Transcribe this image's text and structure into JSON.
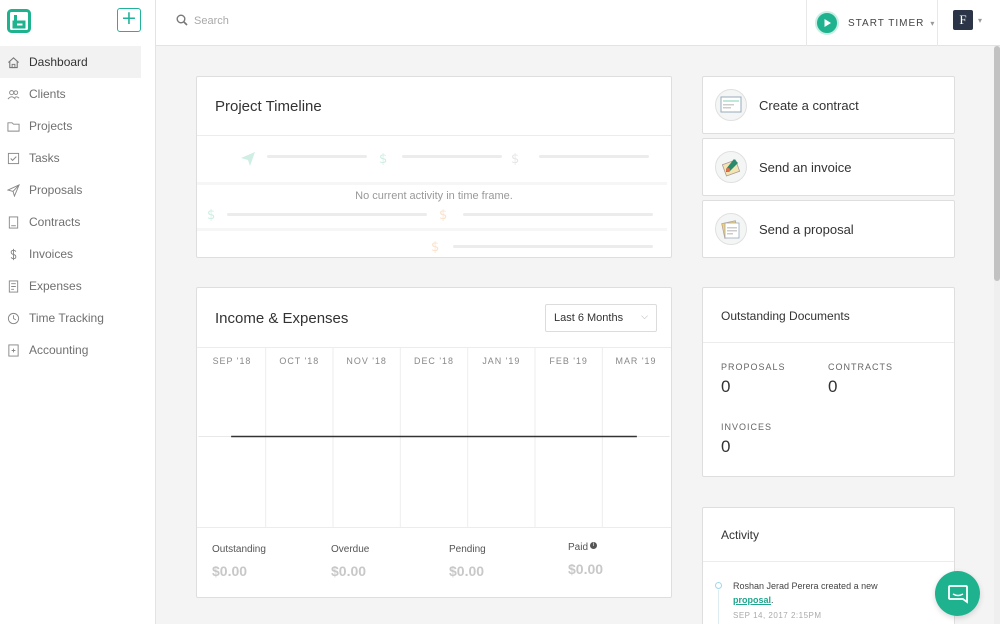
{
  "sidebar": {
    "items": [
      {
        "label": "Dashboard",
        "icon": "home-icon",
        "active": true
      },
      {
        "label": "Clients",
        "icon": "clients-icon"
      },
      {
        "label": "Projects",
        "icon": "folder-icon"
      },
      {
        "label": "Tasks",
        "icon": "checkbox-icon"
      },
      {
        "label": "Proposals",
        "icon": "paper-plane-icon"
      },
      {
        "label": "Contracts",
        "icon": "document-icon"
      },
      {
        "label": "Invoices",
        "icon": "dollar-icon"
      },
      {
        "label": "Expenses",
        "icon": "receipt-icon"
      },
      {
        "label": "Time Tracking",
        "icon": "clock-icon"
      },
      {
        "label": "Accounting",
        "icon": "ledger-icon"
      }
    ],
    "add_label": "+"
  },
  "topbar": {
    "search_placeholder": "Search",
    "timer_label": "START TIMER",
    "avatar_initials": "F"
  },
  "project_timeline": {
    "title": "Project Timeline",
    "empty_text": "No current activity in time frame."
  },
  "income_expenses": {
    "title": "Income & Expenses",
    "range": "Last 6 Months",
    "months": [
      "SEP '18",
      "OCT '18",
      "NOV '18",
      "DEC '18",
      "JAN '19",
      "FEB '19",
      "MAR '19"
    ],
    "stats": [
      {
        "label": "Outstanding",
        "value": "$0.00"
      },
      {
        "label": "Overdue",
        "value": "$0.00"
      },
      {
        "label": "Pending",
        "value": "$0.00"
      },
      {
        "label": "Paid",
        "value": "$0.00"
      }
    ]
  },
  "actions": [
    {
      "label": "Create a contract",
      "icon": "contract-illustration-icon"
    },
    {
      "label": "Send an invoice",
      "icon": "invoice-illustration-icon"
    },
    {
      "label": "Send a proposal",
      "icon": "proposal-illustration-icon"
    }
  ],
  "outstanding": {
    "title": "Outstanding Documents",
    "proposals_label": "PROPOSALS",
    "proposals_value": "0",
    "contracts_label": "CONTRACTS",
    "contracts_value": "0",
    "invoices_label": "INVOICES",
    "invoices_value": "0"
  },
  "activity": {
    "title": "Activity",
    "entry_prefix": "Roshan Jerad Perera created a new",
    "entry_link": "proposal",
    "entry_suffix": ".",
    "entry_time": "SEP 14, 2017 2:15PM"
  },
  "colors": {
    "accent": "#1fb28f",
    "sidebar_bg": "#ffffff",
    "page_bg": "#f4f4f4"
  }
}
